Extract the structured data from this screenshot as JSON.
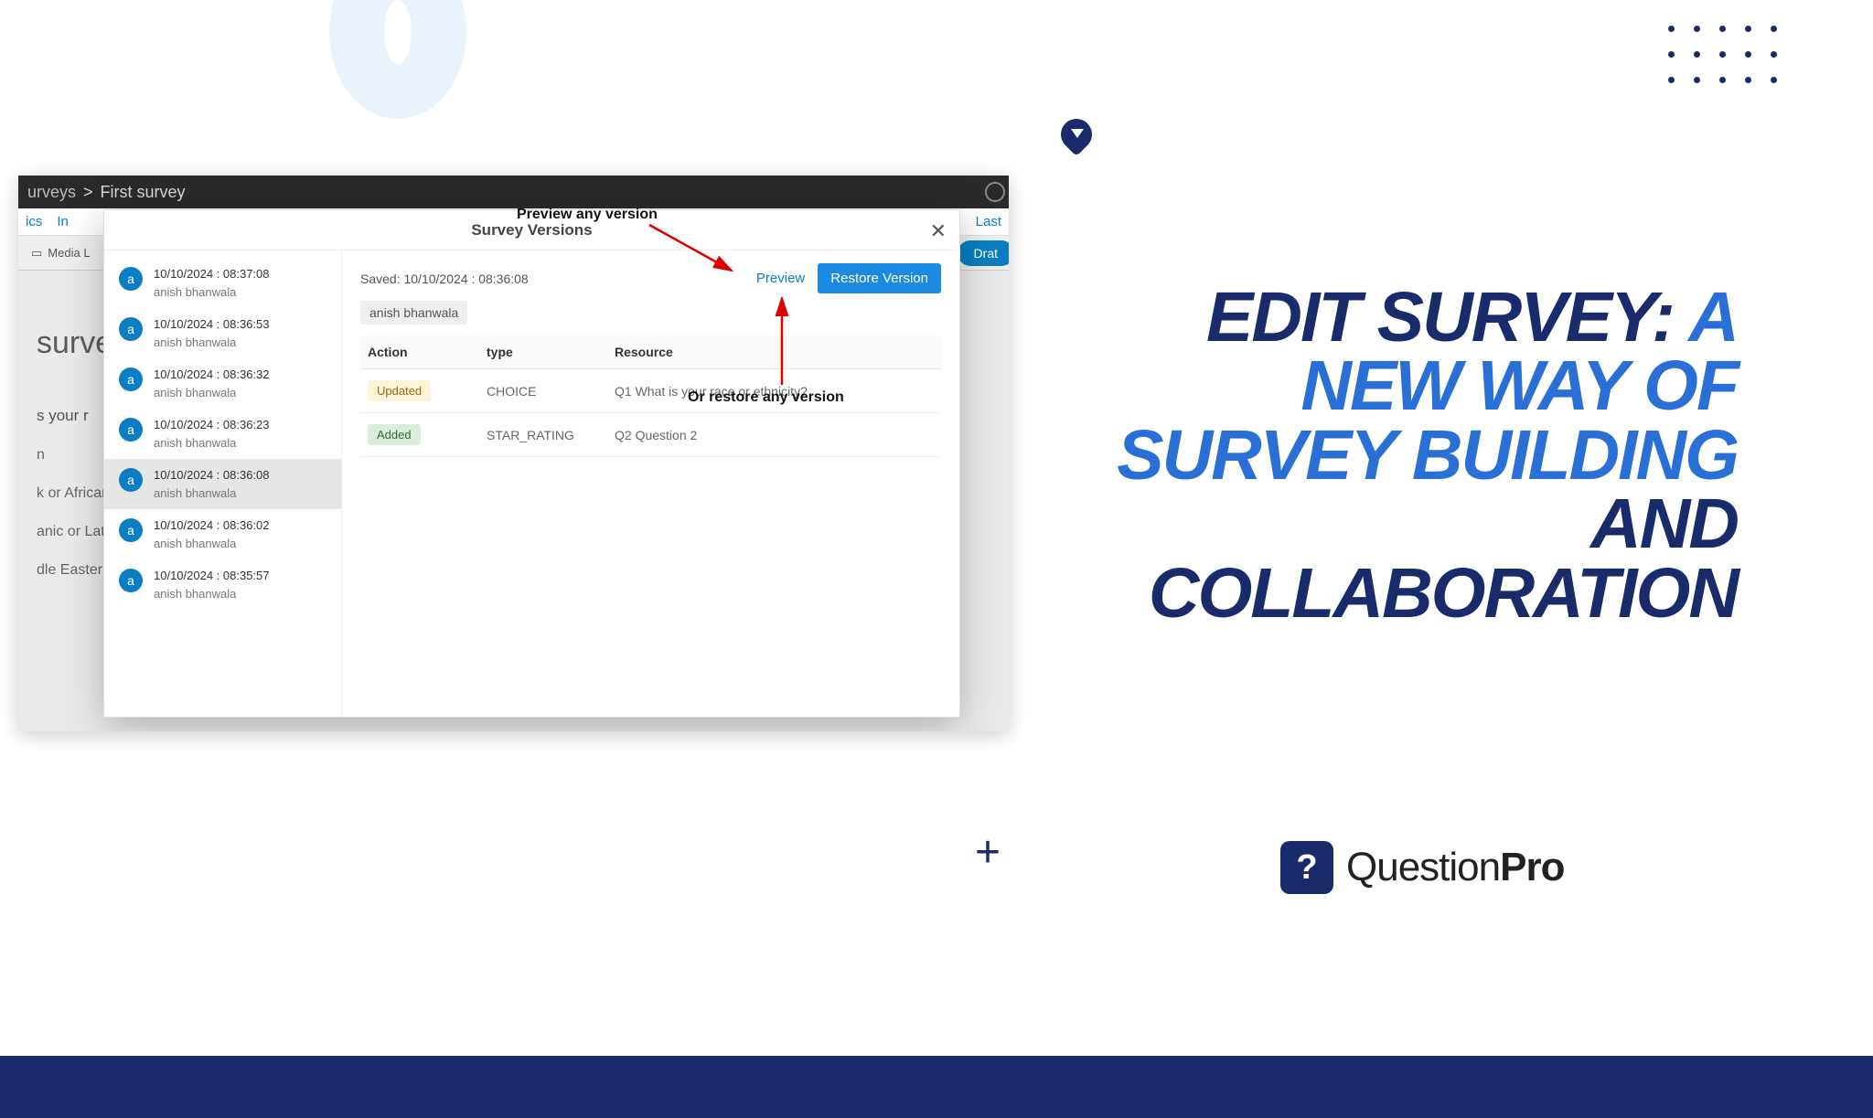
{
  "breadcrumb": {
    "parent": "urveys",
    "sep": ">",
    "current": "First survey"
  },
  "tabs": {
    "left1": "ics",
    "left2": "In",
    "right": "Last"
  },
  "toolbar": {
    "media": "Media L",
    "draft": "Drat"
  },
  "survey_bg": {
    "title": "surve",
    "question": "s your r",
    "options": [
      "n",
      "k or African American",
      "anic or Latino",
      "dle Eastern or North African"
    ]
  },
  "modal": {
    "title": "Survey Versions",
    "saved_prefix": "Saved: ",
    "saved_ts": "10/10/2024 : 08:36:08",
    "author_chip": "anish bhanwala",
    "preview": "Preview",
    "restore": "Restore Version",
    "columns": {
      "action": "Action",
      "type": "type",
      "resource": "Resource"
    },
    "rows": [
      {
        "action": "Updated",
        "action_cls": "b-upd",
        "type": "CHOICE",
        "resource": "Q1 What is your race or ethnicity?"
      },
      {
        "action": "Added",
        "action_cls": "b-add",
        "type": "STAR_RATING",
        "resource": "Q2 Question 2"
      }
    ],
    "versions": [
      {
        "ts": "10/10/2024 : 08:37:08",
        "author": "anish bhanwala",
        "sel": false
      },
      {
        "ts": "10/10/2024 : 08:36:53",
        "author": "anish bhanwala",
        "sel": false
      },
      {
        "ts": "10/10/2024 : 08:36:32",
        "author": "anish bhanwala",
        "sel": false
      },
      {
        "ts": "10/10/2024 : 08:36:23",
        "author": "anish bhanwala",
        "sel": false
      },
      {
        "ts": "10/10/2024 : 08:36:08",
        "author": "anish bhanwala",
        "sel": true
      },
      {
        "ts": "10/10/2024 : 08:36:02",
        "author": "anish bhanwala",
        "sel": false
      },
      {
        "ts": "10/10/2024 : 08:35:57",
        "author": "anish bhanwala",
        "sel": false
      }
    ]
  },
  "annotations": {
    "preview": "Preview any version",
    "restore": "Or restore any version"
  },
  "headline": {
    "t1": "EDIT SURVEY: ",
    "t2": "A NEW WAY OF SURVEY BUILDING",
    "t3": " AND COLLABORATION"
  },
  "logo": {
    "mark": "?",
    "name1": "Question",
    "name2": "Pro"
  },
  "avatar_letter": "a"
}
